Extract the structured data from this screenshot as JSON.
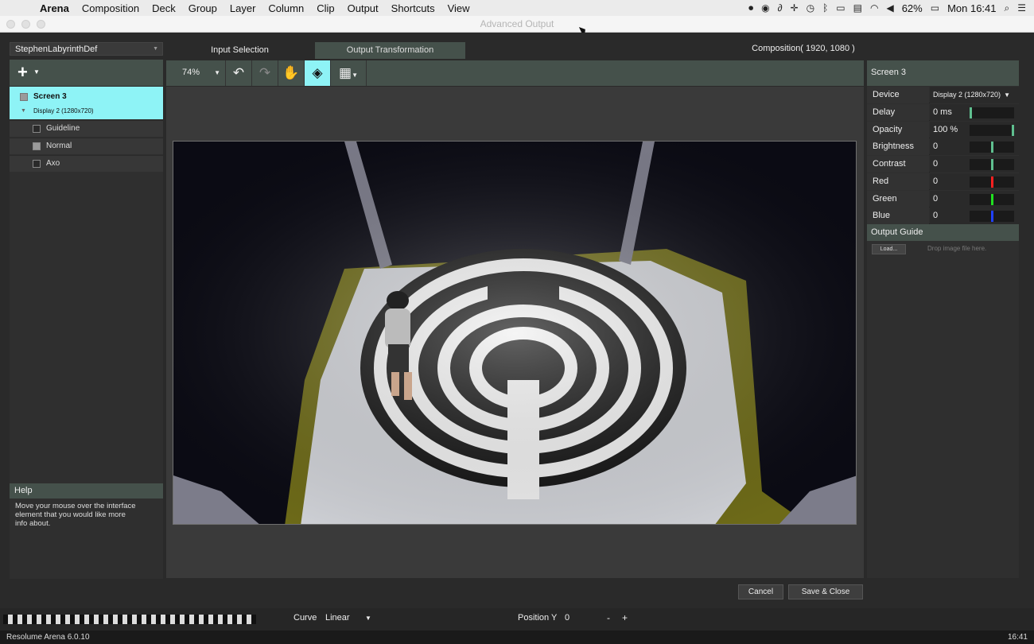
{
  "menubar": {
    "app": "Arena",
    "items": [
      "Composition",
      "Deck",
      "Group",
      "Layer",
      "Column",
      "Clip",
      "Output",
      "Shortcuts",
      "View"
    ],
    "battery": "62%",
    "clock": "Mon 16:41"
  },
  "window": {
    "title": "Advanced Output"
  },
  "left": {
    "preset": "StephenLabyrinthDef",
    "screen_name": "Screen 3",
    "screen_device": "Display 2 (1280x720)",
    "slices": [
      {
        "label": "Guideline",
        "checked": false
      },
      {
        "label": "Normal",
        "checked": true
      },
      {
        "label": "Axo",
        "checked": false
      }
    ],
    "help_title": "Help",
    "help_text": "Move your mouse over the interface element that you would like more info about."
  },
  "tabs": {
    "input": "Input Selection",
    "output": "Output Transformation"
  },
  "composition_label": "Composition( 1920, 1080 )",
  "toolbar": {
    "zoom": "74%"
  },
  "right": {
    "title": "Screen 3",
    "device_label": "Device",
    "device_value": "Display 2 (1280x720)",
    "props": [
      {
        "name": "Delay",
        "value": "0 ms",
        "level": 0.0,
        "color": "#5fbf8f"
      },
      {
        "name": "Opacity",
        "value": "100 %",
        "level": 1.0,
        "color": "#5fbf8f"
      },
      {
        "name": "Brightness",
        "value": "0",
        "level": 0.5,
        "color": "#5fbf8f"
      },
      {
        "name": "Contrast",
        "value": "0",
        "level": 0.5,
        "color": "#5fbf8f"
      },
      {
        "name": "Red",
        "value": "0",
        "level": 0.5,
        "color": "#ff2020"
      },
      {
        "name": "Green",
        "value": "0",
        "level": 0.5,
        "color": "#20e020"
      },
      {
        "name": "Blue",
        "value": "0",
        "level": 0.5,
        "color": "#2040ff"
      }
    ],
    "output_guide": "Output Guide",
    "load": "Load...",
    "drop": "Drop image file here."
  },
  "buttons": {
    "cancel": "Cancel",
    "save": "Save & Close"
  },
  "bottom": {
    "curve_label": "Curve",
    "curve_value": "Linear",
    "posy_label": "Position Y",
    "posy_value": "0",
    "minus": "-",
    "plus": "+"
  },
  "status": {
    "version": "Resolume Arena 6.0.10",
    "time": "16:41"
  }
}
